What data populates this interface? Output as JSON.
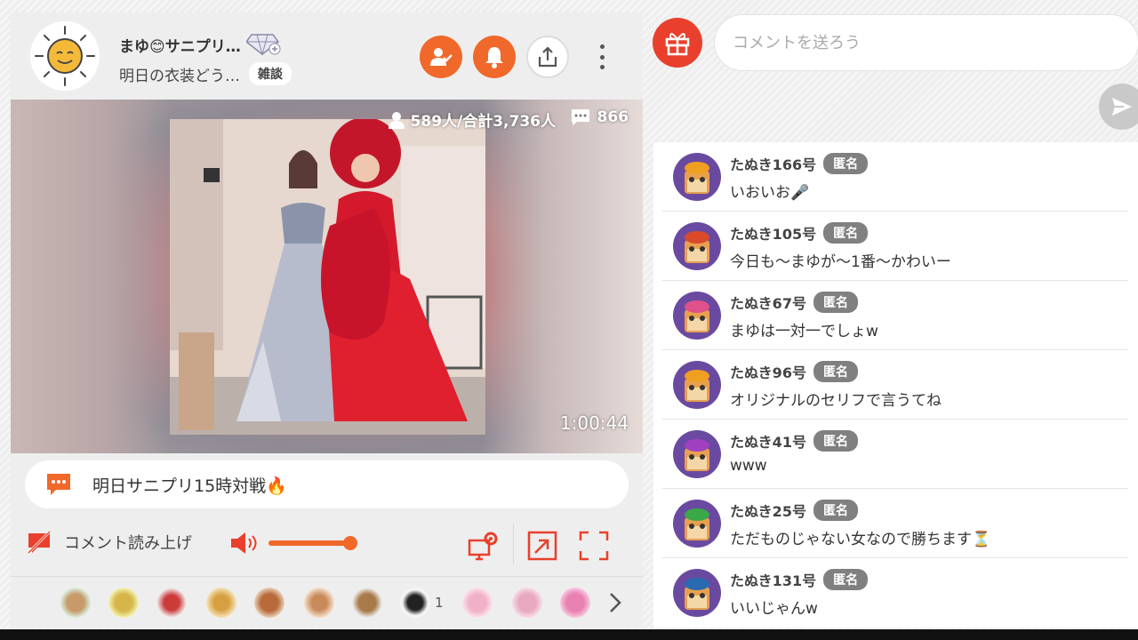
{
  "broadcaster": {
    "name": "まゆ😊サニプリ…",
    "subtitle": "明日の衣装どう…",
    "tag": "雑談"
  },
  "video": {
    "viewers": "589人/合計3,736人",
    "comment_count": "866",
    "elapsed": "1:00:44"
  },
  "telop": {
    "text": "明日サニプリ15時対戦🔥"
  },
  "controls": {
    "read_aloud_label": "コメント読み上げ",
    "volume": 0.9
  },
  "gift_bar": {
    "badge_count": "1"
  },
  "composer": {
    "placeholder": "コメントを送ろう"
  },
  "comments": [
    {
      "name": "たぬき166号",
      "badge": "匿名",
      "text": "いおいお🎤",
      "hat": "#f0a020"
    },
    {
      "name": "たぬき105号",
      "badge": "匿名",
      "text": "今日も〜まゆが〜1番〜かわいー",
      "hat": "#d84a2a"
    },
    {
      "name": "たぬき67号",
      "badge": "匿名",
      "text": "まゆは一対一でしょw",
      "hat": "#e0508a"
    },
    {
      "name": "たぬき96号",
      "badge": "匿名",
      "text": "オリジナルのセリフで言うてね",
      "hat": "#f0a020"
    },
    {
      "name": "たぬき41号",
      "badge": "匿名",
      "text": "www",
      "hat": "#a040c0"
    },
    {
      "name": "たぬき25号",
      "badge": "匿名",
      "text": "ただものじゃない女なので勝ちます⏳",
      "hat": "#3aa848"
    },
    {
      "name": "たぬき131号",
      "badge": "匿名",
      "text": "いいじゃんw",
      "hat": "#2a6ab0"
    }
  ],
  "colors": {
    "accent": "#f0682a",
    "gift_red": "#e8402c",
    "anon_badge": "#808080"
  }
}
